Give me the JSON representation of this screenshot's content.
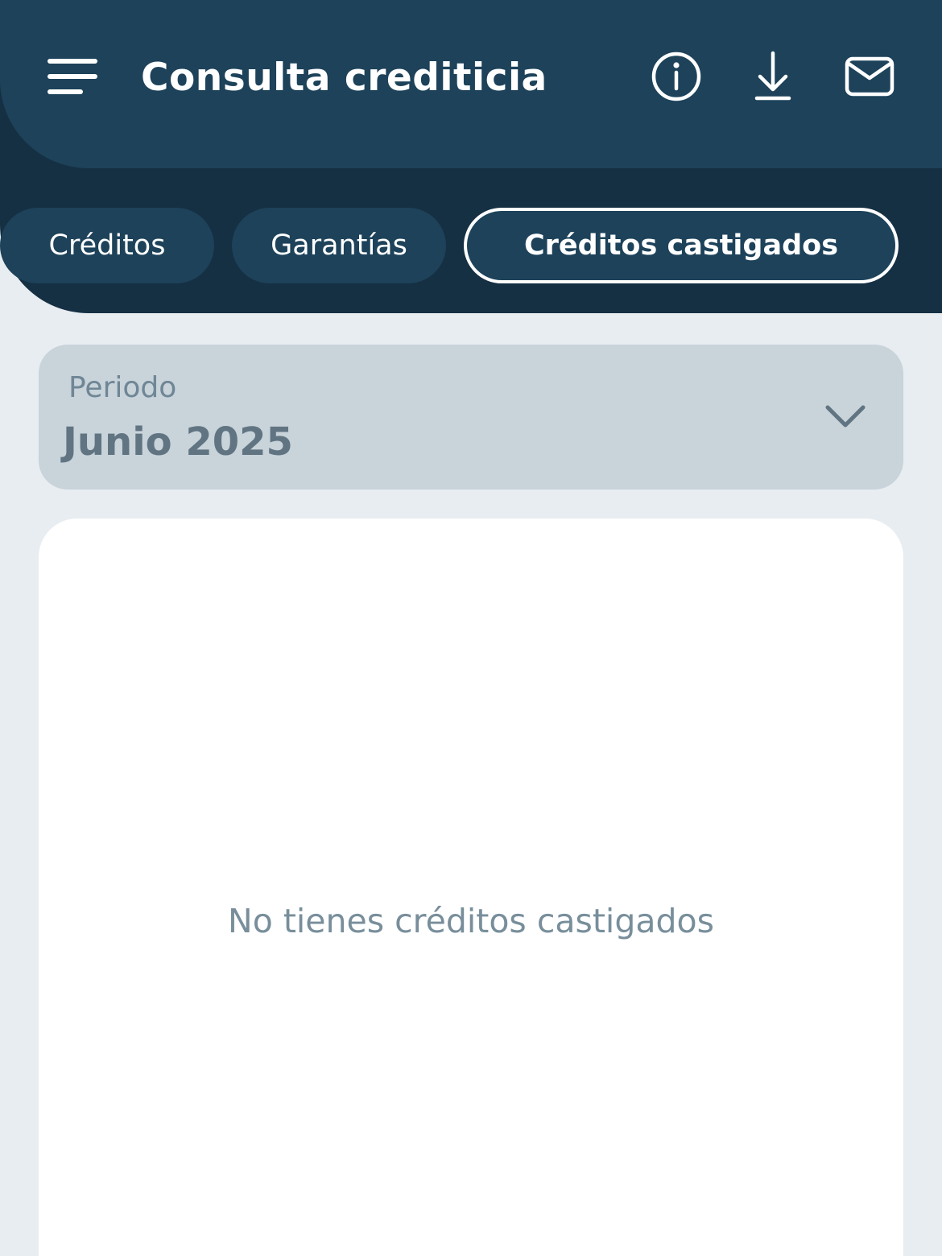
{
  "header": {
    "title": "Consulta crediticia",
    "background_color": "#1d425a",
    "band_color": "#152f43",
    "icons": [
      "menu-icon",
      "info-icon",
      "download-icon",
      "mail-icon"
    ]
  },
  "tabs": [
    {
      "label": "Créditos",
      "active": false
    },
    {
      "label": "Garantías",
      "active": false
    },
    {
      "label": "Créditos castigados",
      "active": true
    }
  ],
  "period_selector": {
    "label": "Periodo",
    "value": "Junio 2025",
    "icon": "chevron-down-icon"
  },
  "content": {
    "empty_message": "No tienes créditos castigados"
  }
}
